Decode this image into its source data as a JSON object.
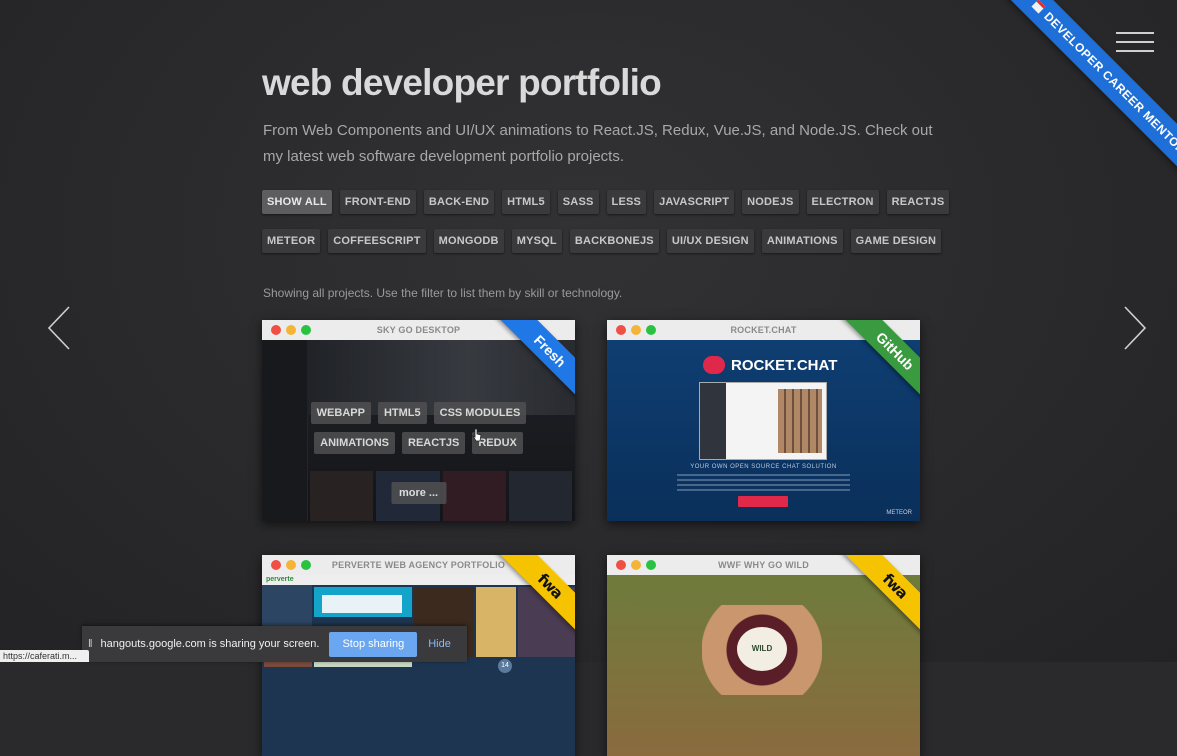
{
  "corner_ribbon": {
    "label": "DEVELOPER CAREER MENTORSHI"
  },
  "header": {
    "title": "web developer portfolio",
    "intro": "From Web Components and UI/UX animations to React.JS, Redux, Vue.JS, and Node.JS. Check out my latest web software development portfolio projects."
  },
  "filters": {
    "row1": [
      "SHOW ALL",
      "FRONT-END",
      "BACK-END",
      "HTML5",
      "SASS",
      "LESS",
      "JAVASCRIPT",
      "NODEJS",
      "ELECTRON",
      "REACTJS"
    ],
    "row2": [
      "METEOR",
      "COFFEESCRIPT",
      "MONGODB",
      "MYSQL",
      "BACKBONEJS",
      "UI/UX DESIGN",
      "ANIMATIONS",
      "GAME DESIGN"
    ],
    "active": "SHOW ALL"
  },
  "showing_text": "Showing all projects. Use the filter to list them by skill or technology.",
  "projects": [
    {
      "title": "SKY GO DESKTOP",
      "ribbon": "Fresh",
      "tags_row1": [
        "WEBAPP",
        "HTML5",
        "CSS MODULES"
      ],
      "tags_row2": [
        "ANIMATIONS",
        "REACTJS",
        "REDUX"
      ],
      "more": "more ..."
    },
    {
      "title": "ROCKET.CHAT",
      "ribbon": "GitHub",
      "logo_text": "ROCKET.CHAT",
      "tagline": "YOUR OWN OPEN SOURCE CHAT SOLUTION",
      "footer": "METEOR"
    },
    {
      "title": "PERVERTE WEB AGENCY PORTFOLIO",
      "ribbon": "fwa",
      "site_name": "perverte",
      "badge": "14"
    },
    {
      "title": "WWF WHY GO WILD",
      "ribbon": "fwa",
      "badge_text": "WILD"
    }
  ],
  "share_bar": {
    "message": "hangouts.google.com is sharing your screen.",
    "stop_label": "Stop sharing",
    "hide_label": "Hide"
  },
  "status_url": "https://caferati.m..."
}
